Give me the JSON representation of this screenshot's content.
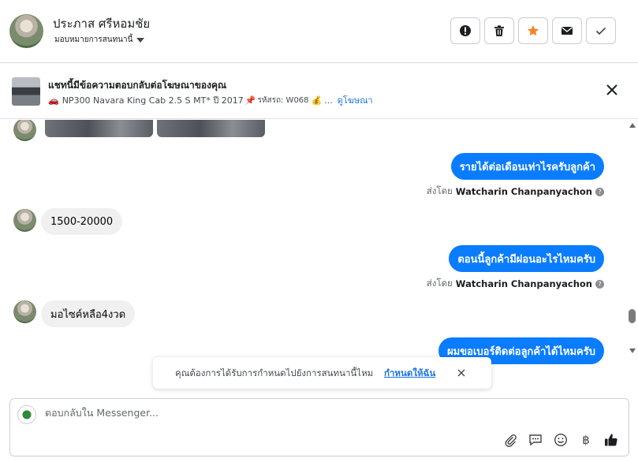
{
  "header": {
    "contact_name": "ประภาส ศรีหอมชัย",
    "assign_label": "มอบหมายการสนทนานี้",
    "actions": [
      {
        "name": "spam",
        "icon": "alert-icon"
      },
      {
        "name": "delete",
        "icon": "trash-icon"
      },
      {
        "name": "star",
        "icon": "star-icon",
        "color": "#f5822a"
      },
      {
        "name": "mark-unread",
        "icon": "envelope-icon"
      },
      {
        "name": "done",
        "icon": "check-icon"
      }
    ]
  },
  "ad_banner": {
    "title": "แชทนี้มีข้อความตอบกลับต่อโฆษณาของคุณ",
    "car_emoji": "🚗",
    "model_text": "NP300 Navara King Cab 2.5 S MT* ปี 2017",
    "pin_emoji": "📌",
    "code_text": "รหัสรถ: W068",
    "money_emoji": "💰",
    "ellipsis": "...",
    "view_ad_link": "ดูโฆษณา"
  },
  "messages": [
    {
      "type": "out",
      "text": "รายได้ต่อเดือนเท่าไรครับลูกค้า",
      "sent_by_label": "ส่งโดย",
      "sender": "Watcharin Chanpanyachon"
    },
    {
      "type": "in",
      "text": "1500-20000"
    },
    {
      "type": "out",
      "text": "ตอนนี้ลูกค้ามีผ่อนอะไรไหมครับ",
      "sent_by_label": "ส่งโดย",
      "sender": "Watcharin Chanpanyachon"
    },
    {
      "type": "in",
      "text": "มอไซค์หลือ4งวด"
    },
    {
      "type": "out",
      "text": "ผมขอเบอร์ติดต่อลูกค้าได้ไหมครับ"
    }
  ],
  "toast": {
    "text": "คุณต้องการได้รับการกำหนดไปยังการสนทนานี้ไหม",
    "link": "กำหนดให้ฉัน"
  },
  "composer": {
    "placeholder": "ตอบกลับใน Messenger...",
    "baht_symbol": "฿"
  },
  "colors": {
    "accent": "#0a7cff",
    "link": "#1b74e4",
    "incoming_bubble": "#f0f0f0",
    "star": "#f5822a"
  }
}
